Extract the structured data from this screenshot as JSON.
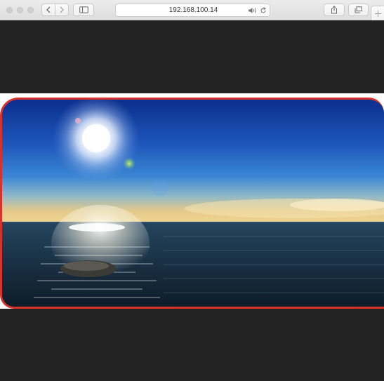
{
  "browser": {
    "address_text": "192.168.100.14",
    "icons": {
      "back": "chevron-left-icon",
      "forward": "chevron-right-icon",
      "sidebar": "sidebar-icon",
      "audio": "speaker-icon",
      "reload": "reload-icon",
      "share": "share-icon",
      "tabs": "tabs-icon",
      "new_tab": "plus-icon"
    }
  },
  "page": {
    "image_frame_color": "#d8322a",
    "background_color": "#232323"
  }
}
